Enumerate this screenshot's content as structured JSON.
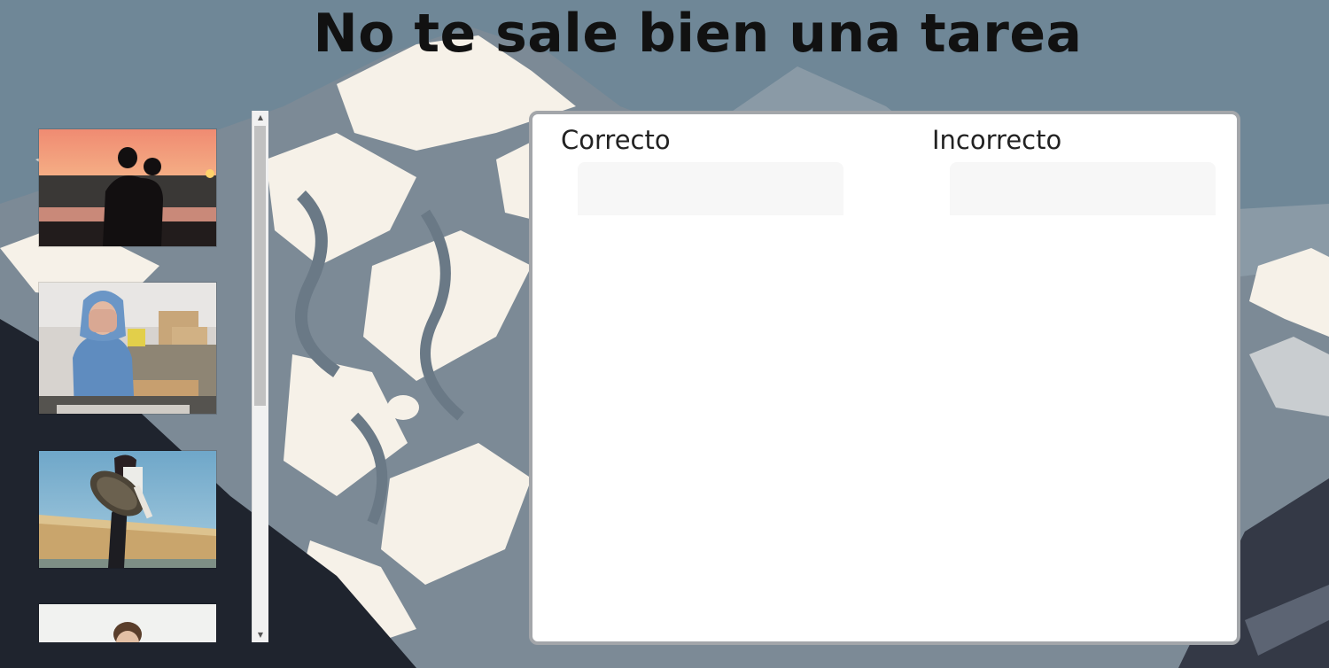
{
  "page": {
    "title": "No te sale bien una tarea"
  },
  "gallery": {
    "items": [
      {
        "icon": "photo-couple-hug-sunset"
      },
      {
        "icon": "photo-man-hoodie-face-palm"
      },
      {
        "icon": "photo-woman-kicking"
      },
      {
        "icon": "photo-man-partial"
      }
    ]
  },
  "scrollbar": {
    "up_icon": "▲",
    "down_icon": "▼"
  },
  "categories": [
    {
      "title": "Correcto"
    },
    {
      "title": "Incorrecto"
    }
  ],
  "colors": {
    "background": "#6f8797",
    "panel_border": "#a3a6aa",
    "drop_zone": "#f7f7f7",
    "mountain_snow": "#f6f1e8",
    "mountain_rock": "#7c8a96",
    "dark_slope": "#1f242e"
  }
}
